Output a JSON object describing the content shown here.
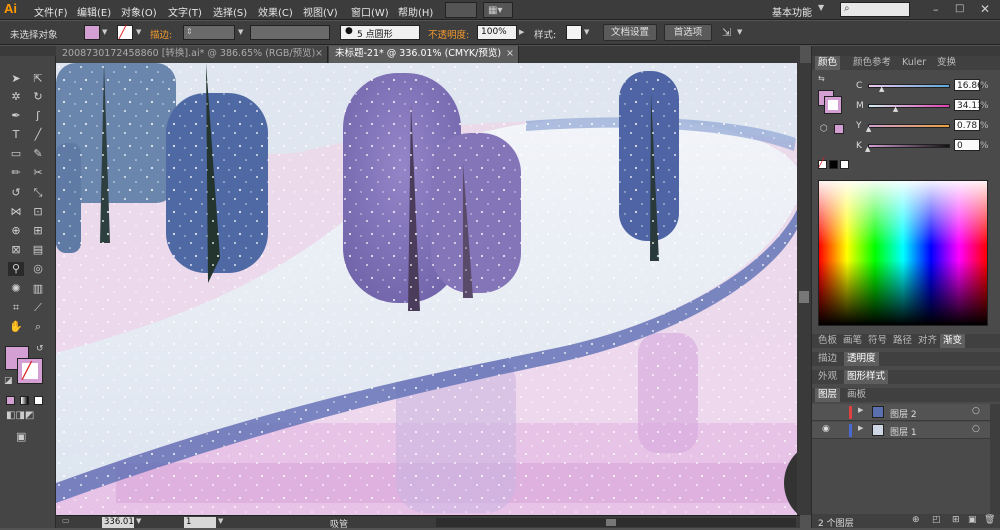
{
  "app": {
    "logo": "Ai"
  },
  "menu": [
    "文件(F)",
    "编辑(E)",
    "对象(O)",
    "文字(T)",
    "选择(S)",
    "效果(C)",
    "视图(V)",
    "窗口(W)",
    "帮助(H)"
  ],
  "workspace": {
    "label": "基本功能"
  },
  "control": {
    "selection_status": "未选择对象",
    "stroke_label": "描边:",
    "brush_size": "5 点圆形",
    "opacity_label": "不透明度:",
    "opacity_value": "100%",
    "style_label": "样式:",
    "doc_setup": "文档设置",
    "preferences": "首选项"
  },
  "tabs": [
    {
      "label": "2008730172458860 [转换].ai* @ 386.65% (RGB/预览)",
      "active": false
    },
    {
      "label": "未标题-21* @ 336.01% (CMYK/预览)",
      "active": true
    }
  ],
  "status": {
    "zoom": "336.01",
    "page": "1",
    "tool_name": "吸管"
  },
  "color_panel": {
    "tabs": [
      "颜色",
      "颜色参考",
      "Kuler",
      "变换"
    ],
    "channels": [
      {
        "name": "C",
        "value": "16.86",
        "level": 0.17
      },
      {
        "name": "M",
        "value": "34.13",
        "level": 0.34
      },
      {
        "name": "Y",
        "value": "0.78",
        "level": 0.01
      },
      {
        "name": "K",
        "value": "0",
        "level": 0.0
      }
    ],
    "fill_color": "#d4a0d4"
  },
  "panel_tabs_row1": [
    "色板",
    "画笔",
    "符号",
    "路径",
    "对齐",
    "渐变"
  ],
  "panel_tabs_row2": [
    "描边",
    "透明度"
  ],
  "panel_tabs_row3": [
    "外观",
    "图形样式"
  ],
  "layers_panel": {
    "tabs": [
      "图层",
      "画板"
    ],
    "layers": [
      {
        "name": "图层 2",
        "color": "#e04040"
      },
      {
        "name": "图层 1",
        "color": "#4a6ad0"
      }
    ],
    "footer": "2 个图层"
  }
}
